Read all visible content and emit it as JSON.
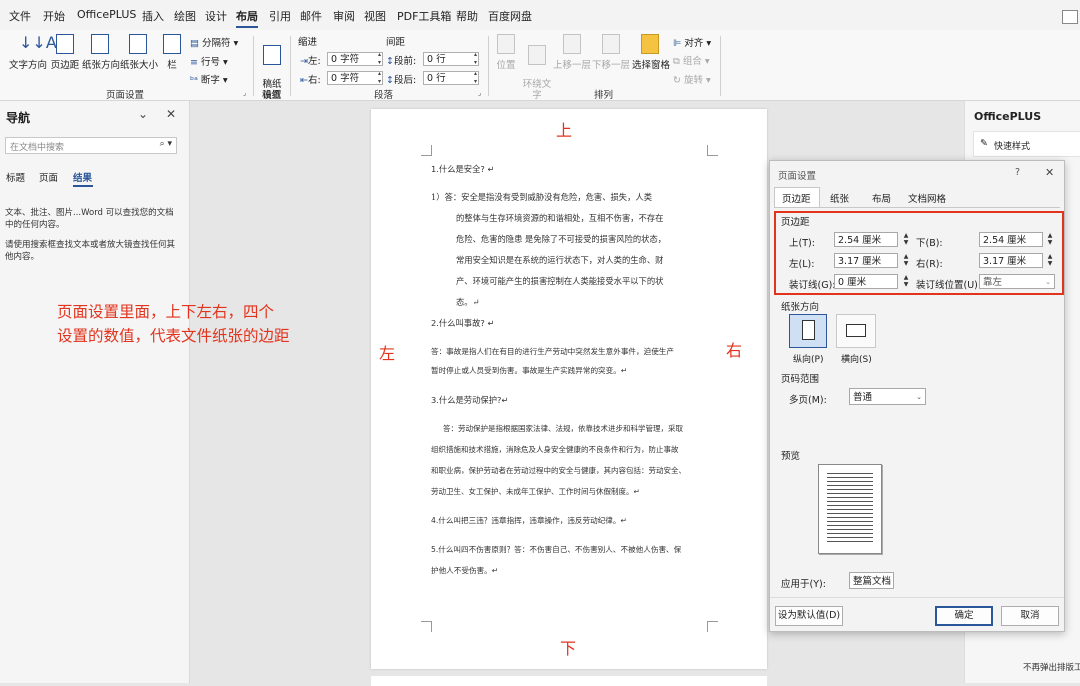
{
  "menubar": {
    "items": [
      "文件",
      "开始",
      "OfficePLUS",
      "插入",
      "绘图",
      "设计",
      "布局",
      "引用",
      "邮件",
      "审阅",
      "视图",
      "PDF工具箱",
      "帮助",
      "百度网盘"
    ],
    "active_index": 6
  },
  "ribbon": {
    "page_setup": {
      "text_direction": "文字方向",
      "margins": "页边距",
      "orientation": "纸张方向",
      "size": "纸张大小",
      "columns": "栏",
      "breaks": "分隔符",
      "line_numbers": "行号",
      "hyphenation": "断字",
      "group_label": "页面设置"
    },
    "manuscript": {
      "button": "稿纸\n设置",
      "group_label": "稿纸"
    },
    "paragraph": {
      "indent_label": "缩进",
      "spacing_label": "间距",
      "left_label": "左:",
      "left_value": "0 字符",
      "right_label": "右:",
      "right_value": "0 字符",
      "before_label": "段前:",
      "before_value": "0 行",
      "after_label": "段后:",
      "after_value": "0 行",
      "group_label": "段落"
    },
    "arrange": {
      "position": "位置",
      "wrap_text": "环绕文\n字",
      "bring_forward": "上移一层",
      "send_backward": "下移一层",
      "selection_pane": "选择窗格",
      "align": "对齐",
      "group": "组合",
      "rotate": "旋转",
      "group_label": "排列"
    }
  },
  "nav": {
    "title": "导航",
    "search_placeholder": "在文档中搜索",
    "tabs": [
      "标题",
      "页面",
      "结果"
    ],
    "active_tab": 2,
    "info1": "文本、批注、图片...Word 可以查找您的文档\n中的任何内容。",
    "info2": "请使用搜索框查找文本或者放大镜查找任何其\n他内容。"
  },
  "annotation": {
    "note": "页面设置里面，上下左右，四个\n设置的数值，代表文件纸张的边距",
    "top": "上",
    "bottom": "下",
    "left": "左",
    "right": "右",
    "color": "#e2341d"
  },
  "doc": {
    "lines": [
      "1.什么是安全? ↵",
      "1）答：安全是指没有受到威胁没有危险，危害、损失，人类",
      "的整体与生存环境资源的和谐相处，互相不伤害，不存在",
      "危险、危害的隐患  是免除了不可接受的损害风险的状态，",
      "常用安全知识是在系统的运行状态下，对人类的生命、财",
      "产、环境可能产生的损害控制在人类能接受水平以下的状",
      "态。↵",
      "2.什么叫事故? ↵",
      "答：事故是指人们在有目的进行生产劳动中突然发生意外事件，迫使生产",
      "暂时停止或人员受到伤害。事故是生产实践异常的突变。↵",
      "3.什么是劳动保护?↵",
      "答：劳动保护是指根据国家法律、法规，依靠技术进步和科学管理，采取",
      "组织措施和技术措施，消除危及人身安全健康的不良条件和行为，防止事故",
      "和职业病，保护劳动者在劳动过程中的安全与健康，其内容包括：劳动安全、",
      "劳动卫生、女工保护、未成年工保护、工作时间与休假制度。↵",
      "4.什么叫把三违？违章指挥，违章操作，违反劳动纪律。↵",
      "5.什么叫四不伤害原则？答：不伤害自己、不伤害别人、不被他人伤害、保",
      "护他人不受伤害。↵"
    ]
  },
  "right_pane": {
    "title": "OfficePLUS",
    "quick_styles": "快速样式",
    "footer": "不再弹出排版工"
  },
  "dialog": {
    "title": "页面设置",
    "help": "?",
    "close": "✕",
    "tabs": [
      "页边距",
      "纸张",
      "布局",
      "文档网格"
    ],
    "active_tab": 0,
    "margins_section": "页边距",
    "top_label": "上(T):",
    "top_value": "2.54 厘米",
    "bottom_label": "下(B):",
    "bottom_value": "2.54 厘米",
    "left_label": "左(L):",
    "left_value": "3.17 厘米",
    "right_label": "右(R):",
    "right_value": "3.17 厘米",
    "gutter_label": "装订线(G):",
    "gutter_value": "0 厘米",
    "gutter_pos_label": "装订线位置(U):",
    "gutter_pos_value": "靠左",
    "orientation_section": "纸张方向",
    "portrait": "纵向(P)",
    "landscape": "横向(S)",
    "pages_section": "页码范围",
    "multiple_pages_label": "多页(M):",
    "multiple_pages_value": "普通",
    "preview_section": "预览",
    "apply_to_label": "应用于(Y):",
    "apply_to_value": "整篇文档",
    "set_default": "设为默认值(D)",
    "ok": "确定",
    "cancel": "取消",
    "highlight_color": "#e2341d"
  }
}
